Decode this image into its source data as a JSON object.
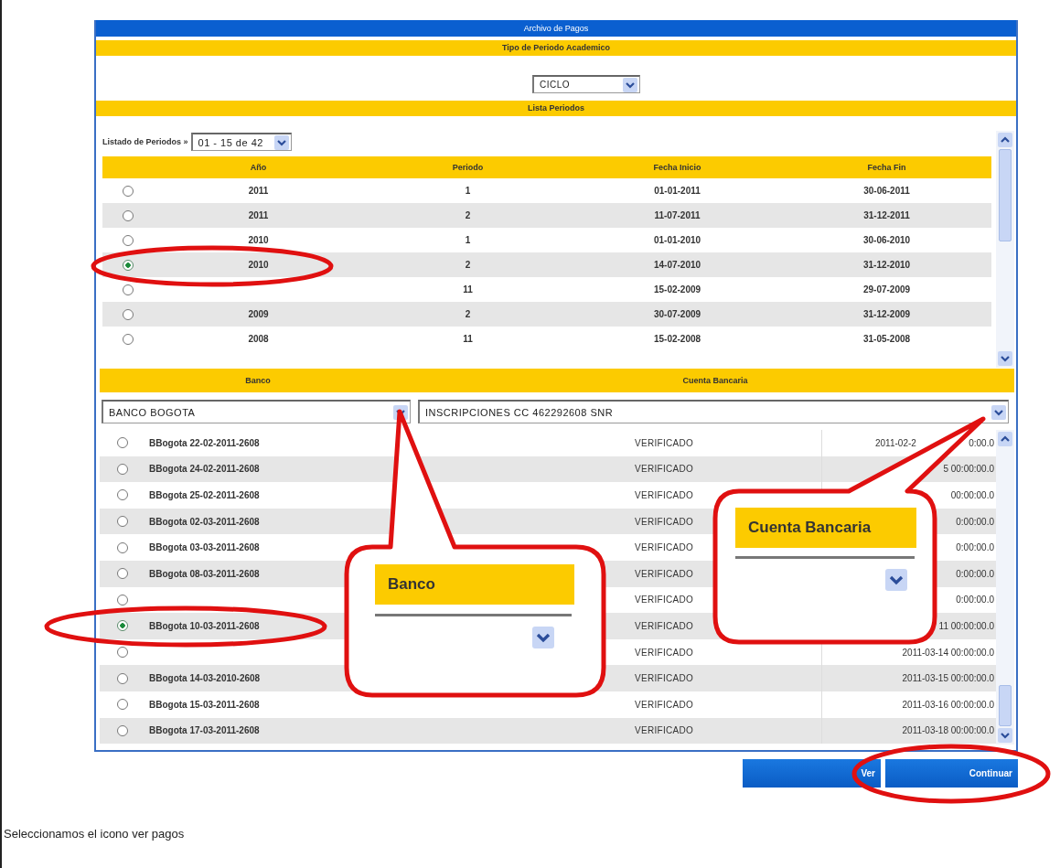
{
  "window_title": "Archivo de Pagos",
  "academic_period_type": {
    "heading": "Tipo de Periodo Academico",
    "select": {
      "value": "CICLO"
    }
  },
  "periods": {
    "heading": "Lista Periodos",
    "pager_label": "Listado de Periodos »",
    "pager": {
      "value": "01 - 15 de 42"
    },
    "columns": [
      "Año",
      "Periodo",
      "Fecha Inicio",
      "Fecha Fin"
    ],
    "rows": [
      {
        "selected": false,
        "circled": false,
        "year": "2011",
        "period": "1",
        "start": "01-01-2011",
        "end": "30-06-2011"
      },
      {
        "selected": false,
        "circled": false,
        "year": "2011",
        "period": "2",
        "start": "11-07-2011",
        "end": "31-12-2011"
      },
      {
        "selected": false,
        "circled": false,
        "year": "2010",
        "period": "1",
        "start": "01-01-2010",
        "end": "30-06-2010"
      },
      {
        "selected": true,
        "circled": true,
        "year": "2010",
        "period": "2",
        "start": "14-07-2010",
        "end": "31-12-2010"
      },
      {
        "selected": false,
        "circled": false,
        "period": "11",
        "start": "15-02-2009",
        "end": "29-07-2009"
      },
      {
        "selected": false,
        "circled": false,
        "year": "2009",
        "period": "2",
        "start": "30-07-2009",
        "end": "31-12-2009"
      },
      {
        "selected": false,
        "circled": false,
        "year": "2008",
        "period": "11",
        "start": "15-02-2008",
        "end": "31-05-2008"
      }
    ]
  },
  "bank": {
    "headings": [
      "Banco",
      "Cuenta Bancaria"
    ],
    "bank_select": {
      "value": "BANCO BOGOTA"
    },
    "account_select": {
      "value": "INSCRIPCIONES CC 462292608 SNR"
    }
  },
  "payments": [
    {
      "selected": false,
      "circled": false,
      "name": "BBogota 22-02-2011-2608",
      "status": "VERIFICADO",
      "date": "2011-02-2",
      "date_end": "0:00.0"
    },
    {
      "selected": false,
      "circled": false,
      "name": "BBogota 24-02-2011-2608",
      "status": "VERIFICADO",
      "date": "5 00:00:00.0"
    },
    {
      "selected": false,
      "circled": false,
      "name": "BBogota 25-02-2011-2608",
      "status": "VERIFICADO",
      "date": "00:00:00.0"
    },
    {
      "selected": false,
      "circled": false,
      "name": "BBogota 02-03-2011-2608",
      "status": "VERIFICADO",
      "date": "0:00:00.0"
    },
    {
      "selected": false,
      "circled": false,
      "name": "BBogota 03-03-2011-2608",
      "status": "VERIFICADO",
      "date": "0:00:00.0"
    },
    {
      "selected": false,
      "circled": false,
      "name": "BBogota 08-03-2011-2608",
      "status": "VERIFICADO",
      "date": "0:00:00.0"
    },
    {
      "selected": false,
      "circled": false,
      "status": "VERIFICADO",
      "date": "0:00:00.0"
    },
    {
      "selected": true,
      "circled": true,
      "name": "BBogota 10-03-2011-2608",
      "status": "VERIFICADO",
      "date": "11 00:00:00.0"
    },
    {
      "selected": false,
      "circled": false,
      "status": "VERIFICADO",
      "date": "2011-03-14 00:00:00.0"
    },
    {
      "selected": false,
      "circled": false,
      "name": "BBogota 14-03-2010-2608",
      "status": "VERIFICADO",
      "date": "2011-03-15 00:00:00.0"
    },
    {
      "selected": false,
      "circled": false,
      "name": "BBogota 15-03-2011-2608",
      "status": "VERIFICADO",
      "date": "2011-03-16 00:00:00.0"
    },
    {
      "selected": false,
      "circled": false,
      "name": "BBogota 17-03-2011-2608",
      "status": "VERIFICADO",
      "date": "2011-03-18 00:00:00.0"
    }
  ],
  "buttons": [
    {
      "label": "Ver",
      "circled": false
    },
    {
      "label": "Continuar",
      "circled": true
    }
  ],
  "callouts": [
    {
      "kind": "bank",
      "label": "Banco"
    },
    {
      "kind": "account",
      "label": "Cuenta Bancaria"
    }
  ],
  "caption": "Seleccionamos el icono ver pagos"
}
